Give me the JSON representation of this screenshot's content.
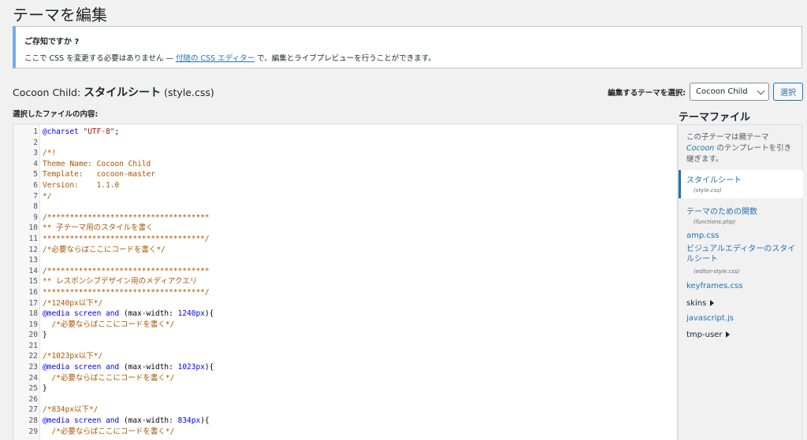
{
  "page": {
    "title": "テーマを編集"
  },
  "notice": {
    "title": "ご存知ですか ?",
    "text_before": "ここで CSS を変更する必要はありません — ",
    "link": "付随の CSS エディター",
    "text_after": " で、編集とライブプレビューを行うことができます。"
  },
  "file_heading": {
    "theme": "Cocoon Child: ",
    "file_title": "スタイルシート",
    "file_name": " (style.css)"
  },
  "theme_select": {
    "label": "編集するテーマを選択:",
    "value": "Cocoon Child",
    "button": "選択"
  },
  "editor": {
    "label": "選択したファイルの内容:",
    "lines": [
      {
        "n": "1",
        "parts": [
          {
            "t": "@charset ",
            "c": "def"
          },
          {
            "t": "\"UTF-8\"",
            "c": "string"
          },
          {
            "t": ";",
            "c": "text"
          }
        ]
      },
      {
        "n": "2",
        "parts": []
      },
      {
        "n": "3",
        "parts": [
          {
            "t": "/*!",
            "c": "comment"
          }
        ]
      },
      {
        "n": "4",
        "parts": [
          {
            "t": "Theme Name: Cocoon Child",
            "c": "comment"
          }
        ]
      },
      {
        "n": "5",
        "parts": [
          {
            "t": "Template:   cocoon-master",
            "c": "comment"
          }
        ]
      },
      {
        "n": "6",
        "parts": [
          {
            "t": "Version:    1.1.0",
            "c": "comment"
          }
        ]
      },
      {
        "n": "7",
        "parts": [
          {
            "t": "*/",
            "c": "comment"
          }
        ]
      },
      {
        "n": "8",
        "parts": []
      },
      {
        "n": "9",
        "parts": [
          {
            "t": "/************************************",
            "c": "comment"
          }
        ]
      },
      {
        "n": "10",
        "parts": [
          {
            "t": "** 子テーマ用のスタイルを書く",
            "c": "comment"
          }
        ]
      },
      {
        "n": "11",
        "parts": [
          {
            "t": "************************************/",
            "c": "comment"
          }
        ]
      },
      {
        "n": "12",
        "parts": [
          {
            "t": "/*必要ならばここにコードを書く*/",
            "c": "comment"
          }
        ]
      },
      {
        "n": "13",
        "parts": []
      },
      {
        "n": "14",
        "parts": [
          {
            "t": "/************************************",
            "c": "comment"
          }
        ]
      },
      {
        "n": "15",
        "parts": [
          {
            "t": "** レスポンシブデザイン用のメディアクエリ",
            "c": "comment"
          }
        ]
      },
      {
        "n": "16",
        "parts": [
          {
            "t": "************************************/",
            "c": "comment"
          }
        ]
      },
      {
        "n": "17",
        "parts": [
          {
            "t": "/*1240px以下*/",
            "c": "comment"
          }
        ]
      },
      {
        "n": "18",
        "parts": [
          {
            "t": "@media screen and ",
            "c": "def"
          },
          {
            "t": "(max-width: ",
            "c": "text"
          },
          {
            "t": "1240px",
            "c": "def"
          },
          {
            "t": "){",
            "c": "text"
          }
        ]
      },
      {
        "n": "19",
        "parts": [
          {
            "t": "  /*必要ならばここにコードを書く*/",
            "c": "comment"
          }
        ]
      },
      {
        "n": "20",
        "parts": [
          {
            "t": "}",
            "c": "text"
          }
        ]
      },
      {
        "n": "21",
        "parts": []
      },
      {
        "n": "22",
        "parts": [
          {
            "t": "/*1023px以下*/",
            "c": "comment"
          }
        ]
      },
      {
        "n": "23",
        "parts": [
          {
            "t": "@media screen and ",
            "c": "def"
          },
          {
            "t": "(max-width: ",
            "c": "text"
          },
          {
            "t": "1023px",
            "c": "def"
          },
          {
            "t": "){",
            "c": "text"
          }
        ]
      },
      {
        "n": "24",
        "parts": [
          {
            "t": "  /*必要ならばここにコードを書く*/",
            "c": "comment"
          }
        ]
      },
      {
        "n": "25",
        "parts": [
          {
            "t": "}",
            "c": "text"
          }
        ]
      },
      {
        "n": "26",
        "parts": []
      },
      {
        "n": "27",
        "parts": [
          {
            "t": "/*834px以下*/",
            "c": "comment"
          }
        ]
      },
      {
        "n": "28",
        "parts": [
          {
            "t": "@media screen and ",
            "c": "def"
          },
          {
            "t": "(max-width: ",
            "c": "text"
          },
          {
            "t": "834px",
            "c": "def"
          },
          {
            "t": "){",
            "c": "text"
          }
        ]
      },
      {
        "n": "29",
        "parts": [
          {
            "t": "  /*必要ならばここにコードを書く*/",
            "c": "comment"
          }
        ]
      }
    ]
  },
  "sidebar": {
    "title": "テーマファイル",
    "desc_1": "この子テーマは親テーマ",
    "desc_parent": "Cocoon",
    "desc_2": " のテンプレートを引き継ぎます。",
    "items": [
      {
        "label": "スタイルシート",
        "sub": "(style.css)"
      },
      {
        "label": "テーマのための関数",
        "sub": "(functions.php)"
      },
      {
        "label": "amp.css"
      },
      {
        "label": "ビジュアルエディターのスタイルシート",
        "sub": "(editor-style.css)"
      },
      {
        "label": "keyframes.css"
      },
      {
        "label": "skins"
      },
      {
        "label": "javascript.js"
      },
      {
        "label": "tmp-user"
      }
    ]
  },
  "colors": {
    "accent": "#2271b1",
    "notice_border": "#72aee6",
    "comment": "#aa5500",
    "keyword": "#0000ff",
    "string": "#aa1111"
  }
}
